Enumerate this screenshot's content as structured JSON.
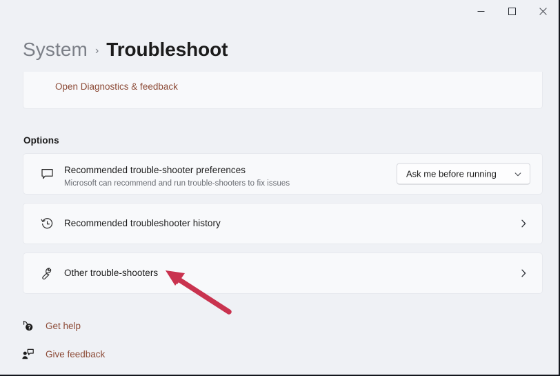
{
  "window": {
    "controls": [
      {
        "name": "minimize",
        "glyph": "minimize-icon"
      },
      {
        "name": "maximize",
        "glyph": "maximize-icon"
      },
      {
        "name": "close",
        "glyph": "close-icon"
      }
    ]
  },
  "breadcrumb": {
    "root": "System",
    "separator": "›",
    "current": "Troubleshoot"
  },
  "top_card": {
    "link_label": "Open Diagnostics & feedback"
  },
  "options": {
    "section_label": "Options",
    "rows": [
      {
        "icon": "chat-bubble-icon",
        "title": "Recommended trouble-shooter preferences",
        "subtitle": "Microsoft can recommend and run trouble-shooters to fix issues",
        "control": "dropdown",
        "dropdown_value": "Ask me before running"
      },
      {
        "icon": "history-icon",
        "title": "Recommended troubleshooter history",
        "subtitle": "",
        "control": "chevron",
        "dropdown_value": ""
      },
      {
        "icon": "wrench-icon",
        "title": "Other trouble-shooters",
        "subtitle": "",
        "control": "chevron",
        "dropdown_value": ""
      }
    ]
  },
  "footer": {
    "links": [
      {
        "icon": "get-help-icon",
        "label": "Get help"
      },
      {
        "icon": "give-feedback-icon",
        "label": "Give feedback"
      }
    ]
  },
  "annotation": {
    "arrow_color": "#c9334f",
    "points_at": "Other trouble-shooters"
  },
  "colors": {
    "page_background": "#eff1f5",
    "card_background": "#f8f9fb",
    "link_text": "#8c4a36",
    "primary_text": "#1b1b1b",
    "secondary_text": "#6a6d73",
    "annotation_red": "#c9334f"
  }
}
